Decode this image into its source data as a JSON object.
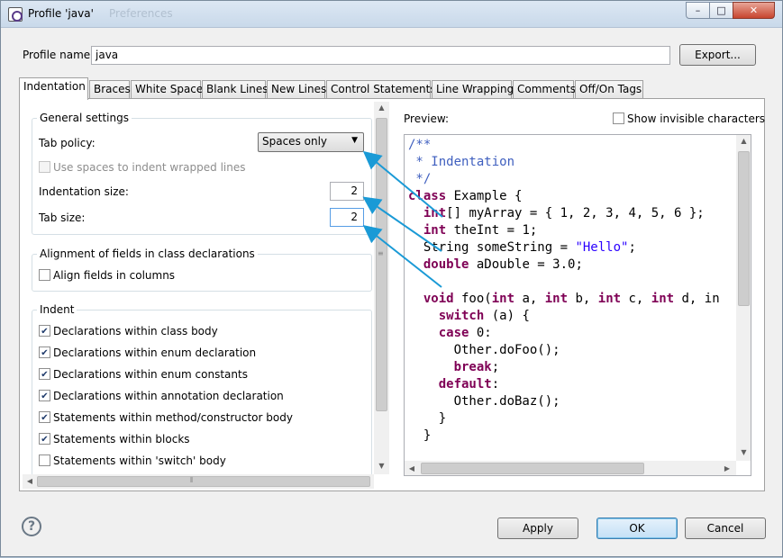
{
  "window": {
    "title": "Profile 'java'",
    "background_title": "Preferences",
    "controls": {
      "minimize": "–",
      "maximize": "□",
      "close": "✕"
    }
  },
  "profile": {
    "name_label": "Profile name:",
    "name_value": "java",
    "export_button": "Export..."
  },
  "tabs": [
    {
      "label": "Indentation",
      "active": true
    },
    {
      "label": "Braces"
    },
    {
      "label": "White Space"
    },
    {
      "label": "Blank Lines"
    },
    {
      "label": "New Lines"
    },
    {
      "label": "Control Statements"
    },
    {
      "label": "Line Wrapping"
    },
    {
      "label": "Comments"
    },
    {
      "label": "Off/On Tags"
    }
  ],
  "general_settings": {
    "title": "General settings",
    "tab_policy_label": "Tab policy:",
    "tab_policy_value": "Spaces only",
    "use_spaces_label": "Use spaces to indent wrapped lines",
    "use_spaces_checked": false,
    "indentation_size_label": "Indentation size:",
    "indentation_size_value": "2",
    "tab_size_label": "Tab size:",
    "tab_size_value": "2"
  },
  "alignment": {
    "title": "Alignment of fields in class declarations",
    "align_fields_label": "Align fields in columns",
    "align_fields_checked": false
  },
  "indent": {
    "title": "Indent",
    "items": [
      {
        "label": "Declarations within class body",
        "checked": true
      },
      {
        "label": "Declarations within enum declaration",
        "checked": true
      },
      {
        "label": "Declarations within enum constants",
        "checked": true
      },
      {
        "label": "Declarations within annotation declaration",
        "checked": true
      },
      {
        "label": "Statements within method/constructor body",
        "checked": true
      },
      {
        "label": "Statements within blocks",
        "checked": true
      },
      {
        "label": "Statements within 'switch' body",
        "checked": false
      }
    ]
  },
  "preview": {
    "label": "Preview:",
    "show_invisible_label": "Show invisible characters",
    "show_invisible_checked": false,
    "code_lines": [
      "/**",
      " * Indentation",
      " */",
      "class Example {",
      "  int[] myArray = { 1, 2, 3, 4, 5, 6 };",
      "  int theInt = 1;",
      "  String someString = \"Hello\";",
      "  double aDouble = 3.0;",
      "",
      "  void foo(int a, int b, int c, int d, in",
      "    switch (a) {",
      "    case 0:",
      "      Other.doFoo();",
      "      break;",
      "    default:",
      "      Other.doBaz();",
      "    }",
      "  }"
    ]
  },
  "footer": {
    "help_icon": "?",
    "apply_button": "Apply",
    "ok_button": "OK",
    "cancel_button": "Cancel"
  },
  "colors": {
    "keyword": "#7f0055",
    "comment": "#3f5fbf",
    "string": "#2a00ff",
    "annotation_arrow": "#1a9ad6"
  }
}
